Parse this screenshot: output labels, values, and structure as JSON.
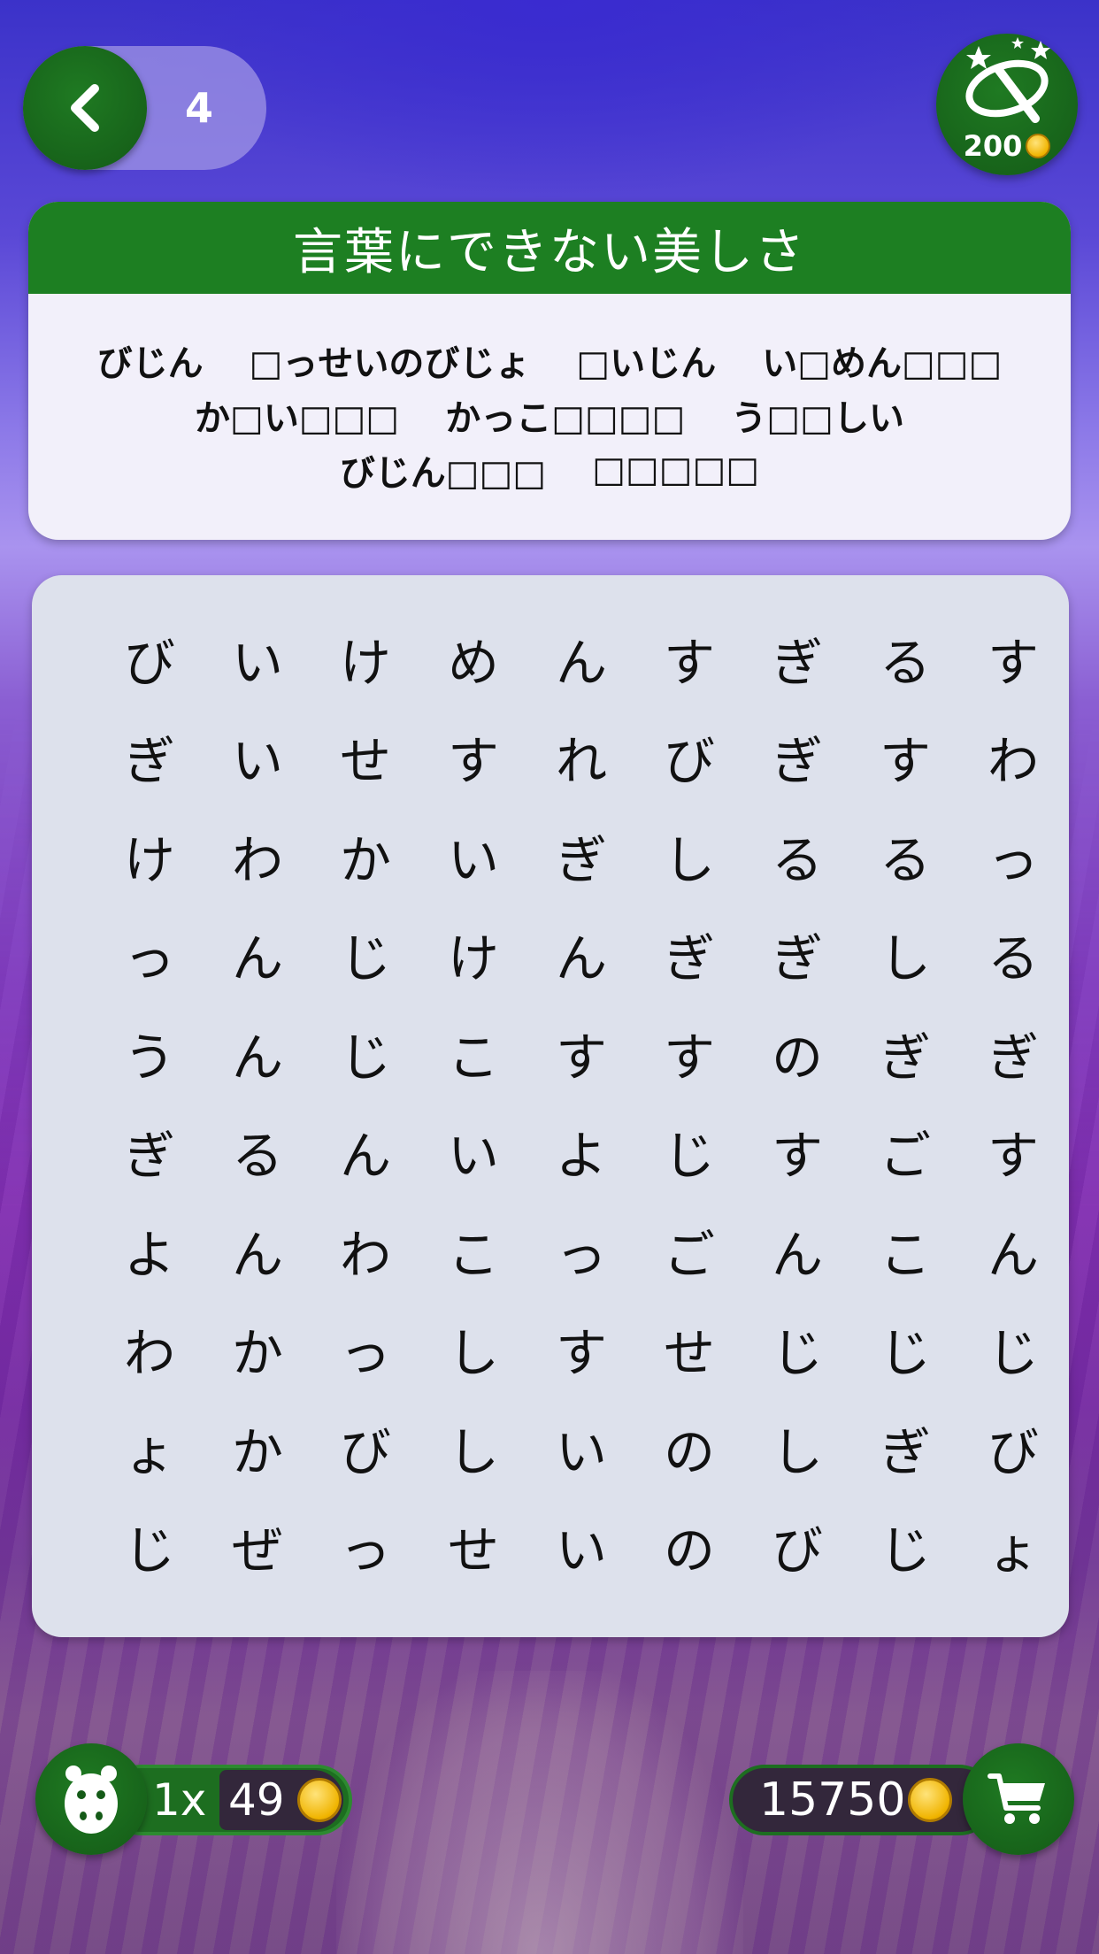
{
  "level": {
    "number": "4"
  },
  "hint": {
    "cost": "200"
  },
  "puzzle": {
    "title": "言葉にできない美しさ",
    "word_lines": [
      [
        "びじん",
        "□っせいのびじょ",
        "□いじん",
        "い□めん□□□"
      ],
      [
        "か□い□□□",
        "かっこ□□□□",
        "う□□しい"
      ],
      [
        "びじん□□□",
        "□□□□□"
      ]
    ],
    "grid": [
      [
        "び",
        "い",
        "け",
        "め",
        "ん",
        "す",
        "ぎ",
        "る",
        "す"
      ],
      [
        "ぎ",
        "い",
        "せ",
        "す",
        "れ",
        "び",
        "ぎ",
        "す",
        "わ"
      ],
      [
        "け",
        "わ",
        "か",
        "い",
        "ぎ",
        "し",
        "る",
        "る",
        "っ"
      ],
      [
        "っ",
        "ん",
        "じ",
        "け",
        "ん",
        "ぎ",
        "ぎ",
        "し",
        "る"
      ],
      [
        "う",
        "ん",
        "じ",
        "こ",
        "す",
        "す",
        "の",
        "ぎ",
        "ぎ"
      ],
      [
        "ぎ",
        "る",
        "ん",
        "い",
        "よ",
        "じ",
        "す",
        "ご",
        "す"
      ],
      [
        "よ",
        "ん",
        "わ",
        "こ",
        "っ",
        "ご",
        "ん",
        "こ",
        "ん"
      ],
      [
        "わ",
        "か",
        "っ",
        "し",
        "す",
        "せ",
        "じ",
        "じ",
        "じ"
      ],
      [
        "ょ",
        "か",
        "び",
        "し",
        "い",
        "の",
        "し",
        "ぎ",
        "び"
      ],
      [
        "じ",
        "ぜ",
        "っ",
        "せ",
        "い",
        "の",
        "び",
        "じ",
        "ょ"
      ]
    ]
  },
  "footer": {
    "multiplier": "1x",
    "coins_earned": "49",
    "balance": "15750"
  },
  "colors": {
    "primary_green": "#1d7f22",
    "coin": "#f0b400",
    "panel": "#f2f0fa",
    "grid_panel": "#dde1ec"
  },
  "icons": {
    "back": "chevron-left-icon",
    "hint": "magic-wand-icon",
    "mascot": "hippo-icon",
    "cart": "shopping-cart-icon",
    "coin": "coin-icon"
  }
}
